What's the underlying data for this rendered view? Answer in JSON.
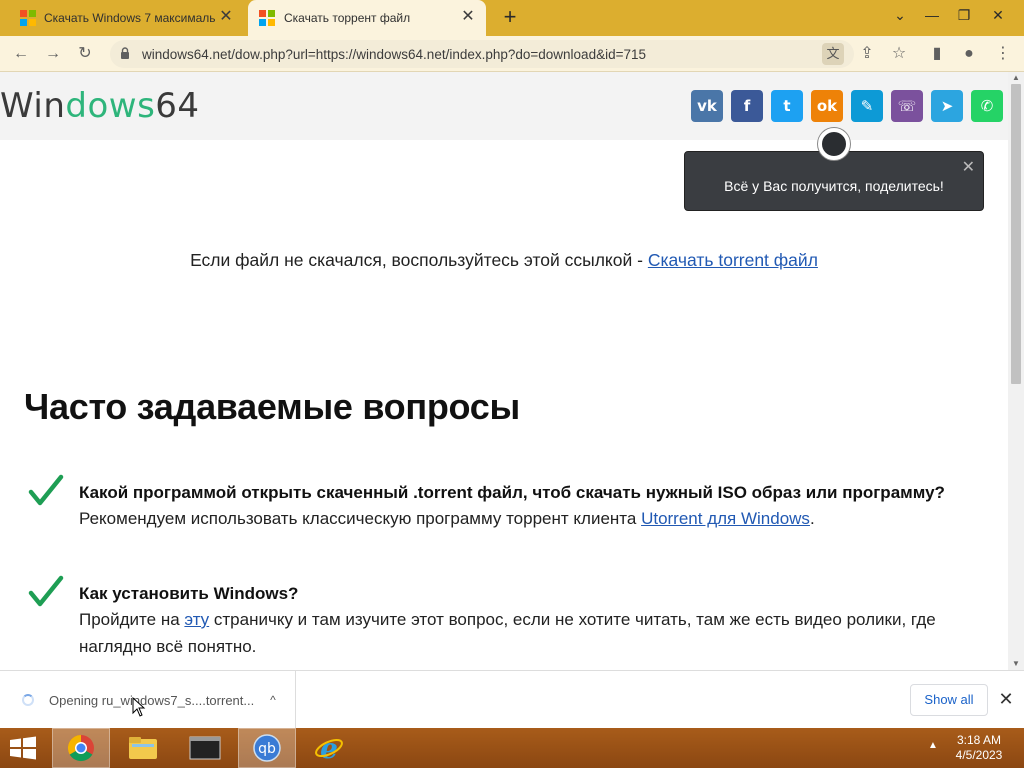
{
  "browser": {
    "tabs": [
      {
        "title": "Скачать Windows 7 максималь"
      },
      {
        "title": "Скачать торрент файл"
      }
    ],
    "new_tab": "+",
    "close_glyph": "✕",
    "url": "windows64.net/dow.php?url=https://windows64.net/index.php?do=download&id=715",
    "window_controls": {
      "minimize": "—",
      "restore": "❐",
      "close": "✕",
      "tab_search": "⌄"
    },
    "nav": {
      "back": "←",
      "forward": "→",
      "reload": "↻"
    }
  },
  "site": {
    "logo_left": "Win",
    "logo_accent": "dows",
    "logo_right": "64",
    "share_buttons": [
      {
        "name": "vk",
        "glyph": "vk",
        "color": "#4a76a8"
      },
      {
        "name": "facebook",
        "glyph": "f",
        "color": "#3b5998"
      },
      {
        "name": "twitter",
        "glyph": "t",
        "color": "#1da1f2"
      },
      {
        "name": "odnoklassniki",
        "glyph": "ok",
        "color": "#ee8208"
      },
      {
        "name": "livejournal",
        "glyph": "✎",
        "color": "#0d9ad6"
      },
      {
        "name": "viber",
        "glyph": "☏",
        "color": "#7b519d"
      },
      {
        "name": "telegram",
        "glyph": "➤",
        "color": "#2ca5e0"
      },
      {
        "name": "whatsapp",
        "glyph": "✆",
        "color": "#25d366"
      }
    ],
    "tooltip_text": "Всё у Вас получится, поделитесь!",
    "tooltip_close": "✕"
  },
  "content": {
    "fallback_text": "Если файл не скачался, воспользуйтесь этой ссылкой - ",
    "fallback_link": "Скачать torrent файл",
    "faq_title": "Часто задаваемые вопросы",
    "faq": [
      {
        "question": "Какой программой открыть скаченный .torrent файл, чтоб скачать нужный ISO образ или программу?",
        "answer_pre": "Рекомендуем использовать классическую программу торрент клиента ",
        "answer_link": "Utorrent для Windows",
        "answer_post": "."
      },
      {
        "question": "Как установить Windows?",
        "answer_pre": "Пройдите на ",
        "answer_link": "эту",
        "answer_post": " страничку и там изучите этот вопрос, если не хотите читать, там же есть видео ролики, где наглядно всё понятно."
      }
    ]
  },
  "download_shelf": {
    "item_text": "Opening ru_windows7_s....torrent...",
    "show_all": "Show all",
    "close": "✕",
    "chevron": "^"
  },
  "taskbar": {
    "time": "3:18 AM",
    "date": "4/5/2023",
    "tray_arrow": "▲"
  }
}
